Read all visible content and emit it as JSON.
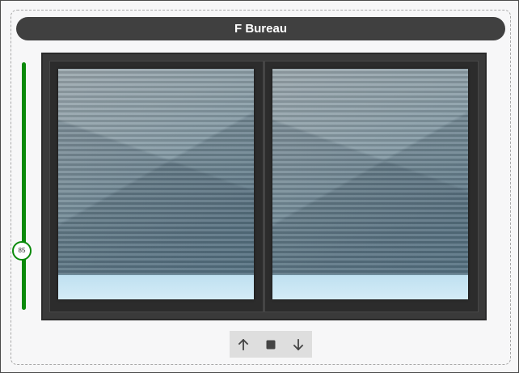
{
  "card": {
    "title": "F Bureau"
  },
  "position_slider": {
    "value": 85,
    "value_label": "85",
    "min": 0,
    "max": 100,
    "color": "#0a8a0a"
  },
  "window": {
    "panes": [
      "left-pane",
      "right-pane"
    ],
    "shutter_open_fraction": 0.85
  },
  "controls": {
    "up_icon": "arrow-up-icon",
    "stop_icon": "stop-square-icon",
    "down_icon": "arrow-down-icon",
    "icon_color": "#444444"
  }
}
